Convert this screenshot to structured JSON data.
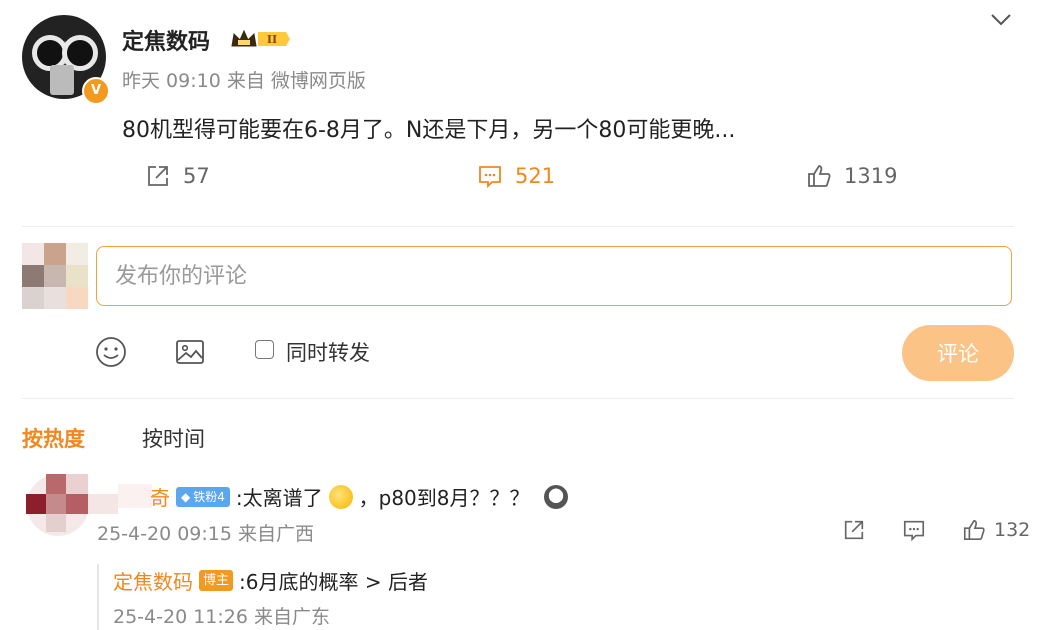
{
  "post": {
    "username": "定焦数码",
    "crown_level": "II",
    "verified_mark": "V",
    "meta": "昨天 09:10 来自 微博网页版",
    "text": "80机型得可能要在6-8月了。N还是下月，另一个80可能更晚...",
    "reposts": "57",
    "comments": "521",
    "likes": "1319"
  },
  "composer": {
    "placeholder": "发布你的评论",
    "checkbox_label": "同时转发",
    "submit_label": "评论"
  },
  "sort": {
    "hot_label": "按热度",
    "time_label": "按时间"
  },
  "comment": {
    "name_tail": "奇",
    "fan_badge": "铁粉4",
    "text_a": ":太离谱了",
    "text_b": "，p80到8月？？？",
    "meta": "25-4-20 09:15 来自广西",
    "likes": "132"
  },
  "reply": {
    "name": "定焦数码",
    "badge": "博主",
    "text": ":6月底的概率 > 后者",
    "meta": "25-4-20 11:26 来自广东"
  },
  "colors": {
    "accent": "#f2871f",
    "input_border": "#f2a23c",
    "button_bg": "#fbc486",
    "fan_badge": "#5aa7f0"
  },
  "icons": [
    "chevron-down-icon",
    "repost-icon",
    "comment-icon",
    "like-icon",
    "emoji-icon",
    "image-icon",
    "verified-icon",
    "crown-icon"
  ]
}
